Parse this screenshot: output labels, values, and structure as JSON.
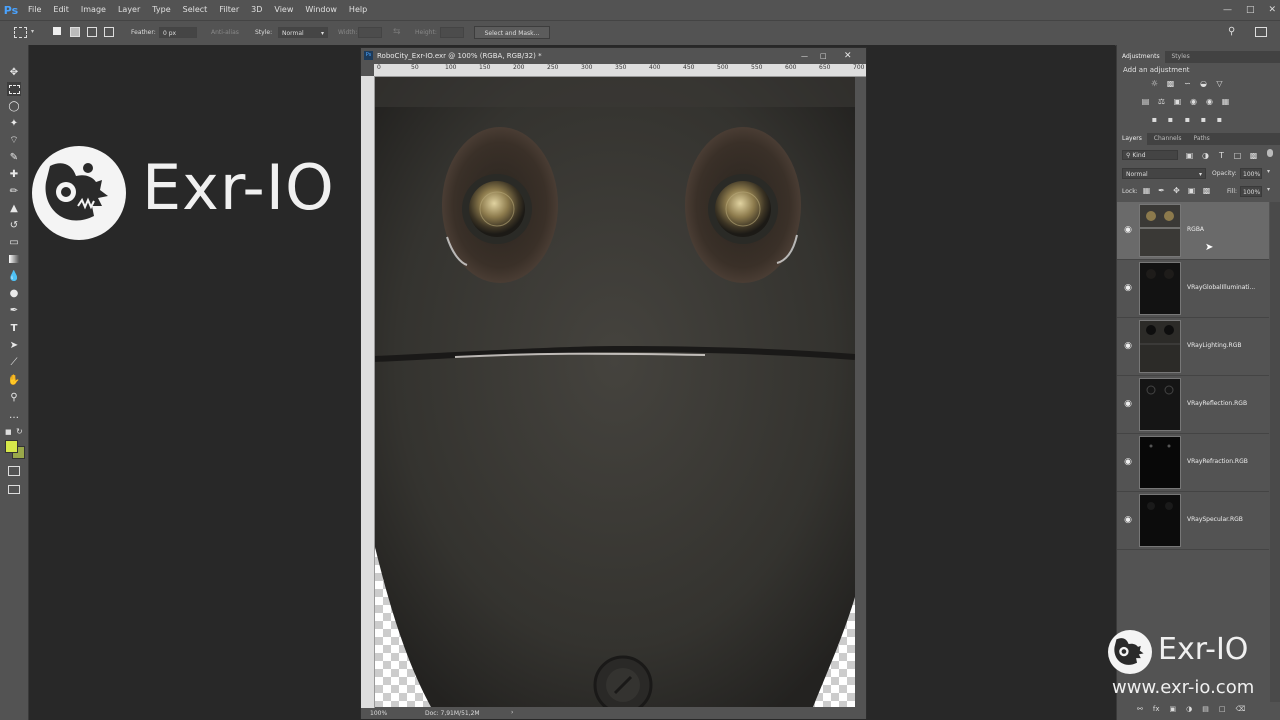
{
  "app": {
    "logo": "Ps"
  },
  "menu": [
    "File",
    "Edit",
    "Image",
    "Layer",
    "Type",
    "Select",
    "Filter",
    "3D",
    "View",
    "Window",
    "Help"
  ],
  "options": {
    "feather_label": "Feather:",
    "feather_value": "0 px",
    "antialias_label": "Anti-alias",
    "style_label": "Style:",
    "style_value": "Normal",
    "width_label": "Width:",
    "height_label": "Height:",
    "select_mask_button": "Select and Mask..."
  },
  "logo": {
    "text": "Exr-IO",
    "url": "www.exr-io.com"
  },
  "document": {
    "title": "RoboCity_Exr-IO.exr @ 100% (RGBA, RGB/32) *",
    "zoom": "100%",
    "doc_info": "Doc: 7,91M/51,2M",
    "ruler_ticks": [
      "0",
      "50",
      "100",
      "150",
      "200",
      "250",
      "300",
      "350",
      "400",
      "450",
      "500",
      "550",
      "600",
      "650",
      "700"
    ]
  },
  "panels": {
    "adjustments_tab": "Adjustments",
    "styles_tab": "Styles",
    "add_adjustment": "Add an adjustment",
    "layers_tab": "Layers",
    "channels_tab": "Channels",
    "paths_tab": "Paths",
    "kind_filter": "Kind",
    "blend_mode": "Normal",
    "opacity_label": "Opacity:",
    "opacity_value": "100%",
    "lock_label": "Lock:",
    "fill_label": "Fill:",
    "fill_value": "100%"
  },
  "layers": [
    {
      "name": "RGBA",
      "selected": true
    },
    {
      "name": "VRayGlobalIlluminati...",
      "selected": false
    },
    {
      "name": "VRayLighting.RGB",
      "selected": false
    },
    {
      "name": "VRayReflection.RGB",
      "selected": false
    },
    {
      "name": "VRayRefraction.RGB",
      "selected": false
    },
    {
      "name": "VRaySpecular.RGB",
      "selected": false
    }
  ],
  "colors": {
    "foreground": "#d7e84a",
    "background": "#9aa84a",
    "accent": "#4aa3ff"
  }
}
